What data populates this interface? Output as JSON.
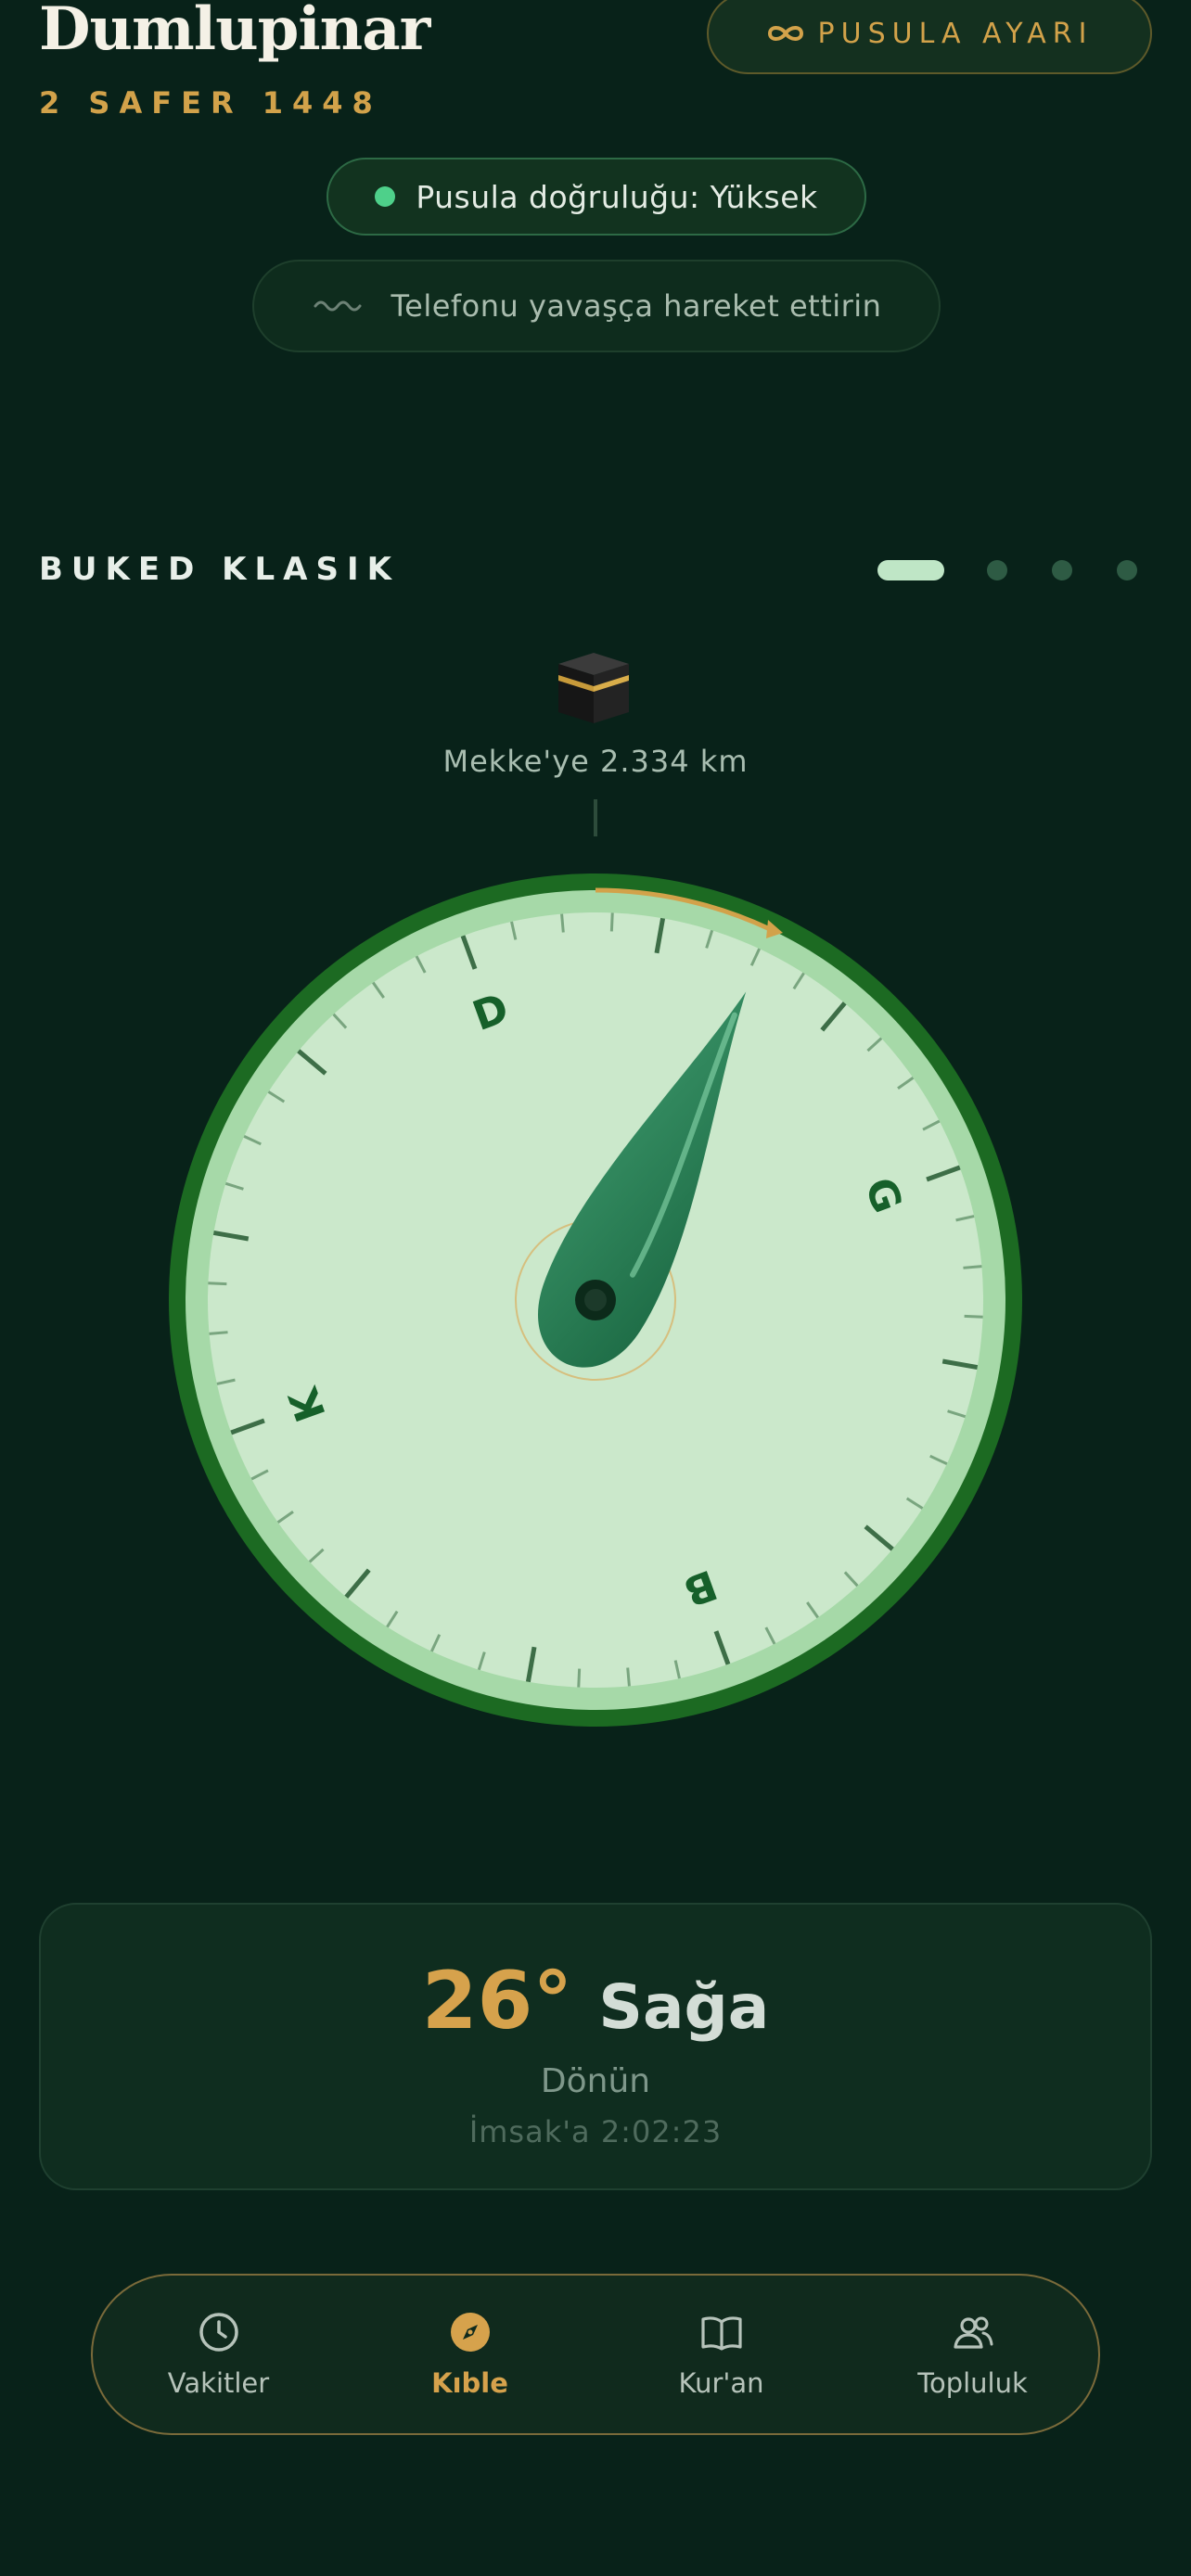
{
  "header": {
    "city": "Dumlupinar",
    "hijri_date": "2 SAFER 1448",
    "calibrate_label": "PUSULA AYARI",
    "calibrate_icon": "infinity-icon"
  },
  "status": {
    "accuracy_text": "Pusula doğruluğu: Yüksek",
    "accuracy_color": "#4ed08a",
    "hint_text": "Telefonu yavaşça hareket ettirin",
    "hint_icon": "wave-icon"
  },
  "style_picker": {
    "label": "BUKED KLASIK",
    "pages": 4,
    "active_page": 1
  },
  "qibla": {
    "kaaba_icon": "kaaba-icon",
    "distance": "Mekke'ye 2.334 km",
    "compass_letters": {
      "north": "D",
      "east": "G",
      "south": "B",
      "west": "K"
    },
    "needle_heading_deg": 26
  },
  "turn": {
    "angle": "26°",
    "direction": "Sağa",
    "instruction": "Dönün",
    "countdown": "İmsak'a 2:02:23"
  },
  "nav": {
    "items": [
      {
        "label": "Vakitler",
        "icon": "clock-icon",
        "active": false
      },
      {
        "label": "Kıble",
        "icon": "compass-icon",
        "active": true
      },
      {
        "label": "Kur'an",
        "icon": "book-icon",
        "active": false
      },
      {
        "label": "Topluluk",
        "icon": "people-icon",
        "active": false
      }
    ]
  },
  "colors": {
    "background": "#082219",
    "accent_gold": "#d6a24c",
    "compass_face": "#cbe8cb",
    "compass_ring": "#1e6a24"
  }
}
